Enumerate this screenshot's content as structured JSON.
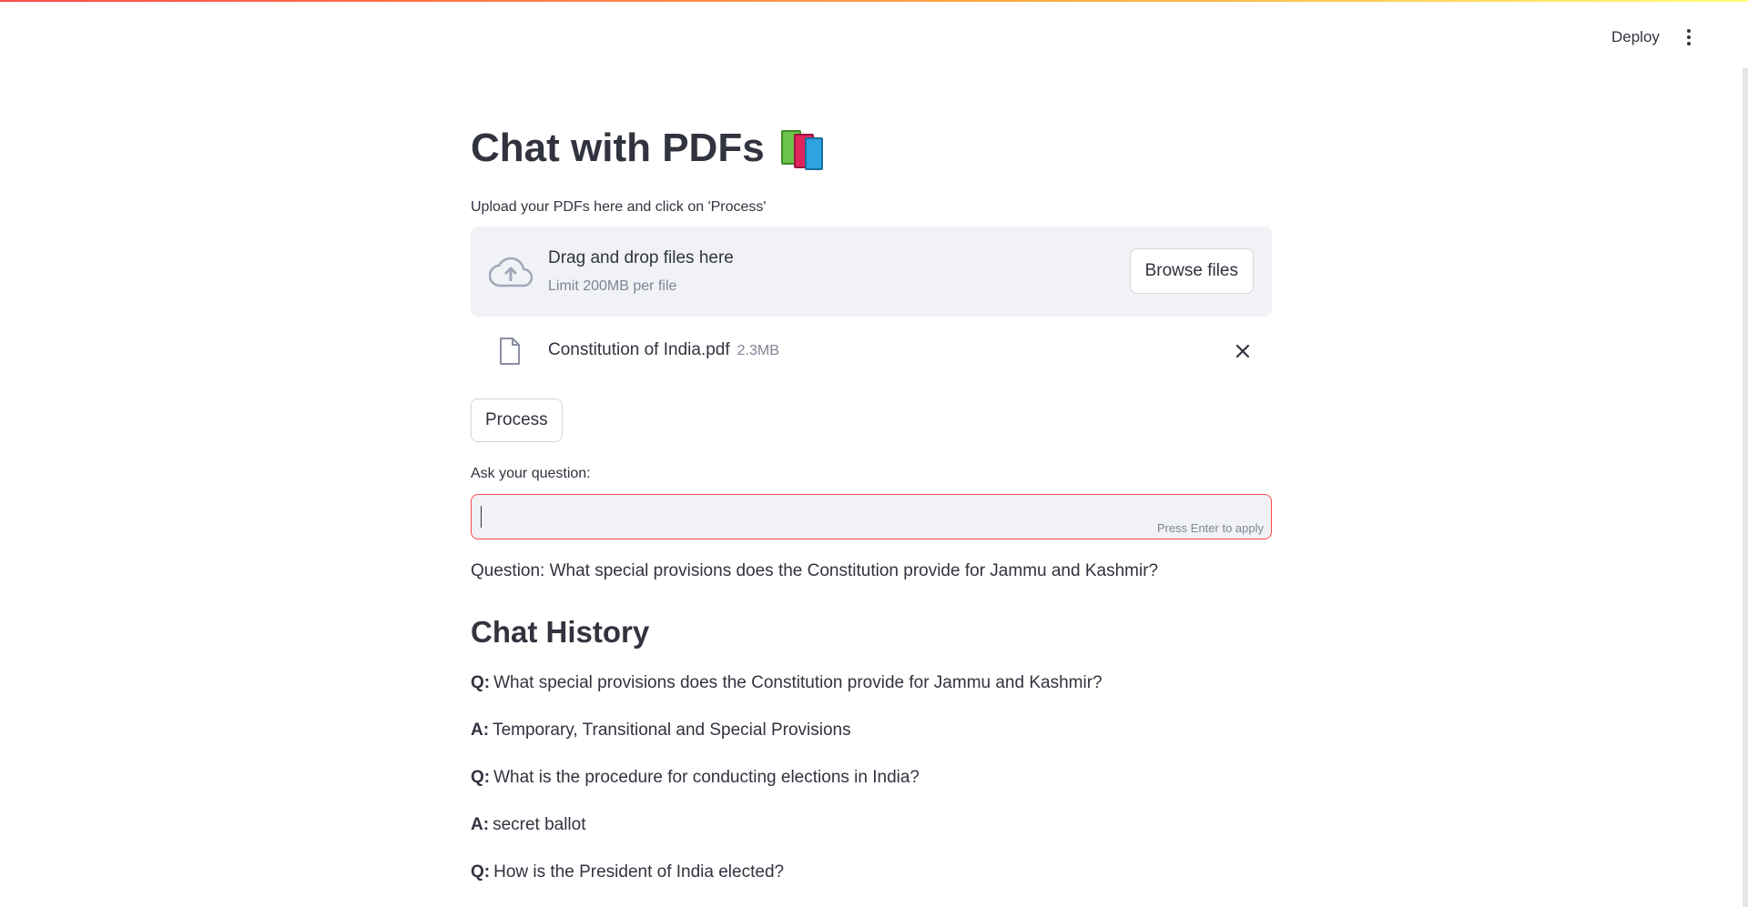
{
  "header": {
    "deploy_label": "Deploy"
  },
  "main": {
    "title": "Chat with PDFs",
    "upload_label": "Upload your PDFs here and click on 'Process'",
    "dropzone": {
      "title": "Drag and drop files here",
      "limit": "Limit 200MB per file",
      "browse_label": "Browse files"
    },
    "file": {
      "name": "Constitution of India.pdf",
      "size": "2.3MB"
    },
    "process_label": "Process",
    "ask_label": "Ask your question:",
    "input": {
      "value": "",
      "hint": "Press Enter to apply"
    },
    "question_text": "Question: What special provisions does the Constitution provide for Jammu and Kashmir?",
    "history_title": "Chat History",
    "history": [
      {
        "prefix": "Q:",
        "text": "What special provisions does the Constitution provide for Jammu and Kashmir?"
      },
      {
        "prefix": "A:",
        "text": "Temporary, Transitional and Special Provisions"
      },
      {
        "prefix": "Q:",
        "text": "What is the procedure for conducting elections in India?"
      },
      {
        "prefix": "A:",
        "text": "secret ballot"
      },
      {
        "prefix": "Q:",
        "text": "How is the President of India elected?"
      }
    ]
  },
  "colors": {
    "accent": "#ff4b4b",
    "text": "#31333f",
    "muted": "#808495",
    "panel": "#f0f2f6"
  }
}
